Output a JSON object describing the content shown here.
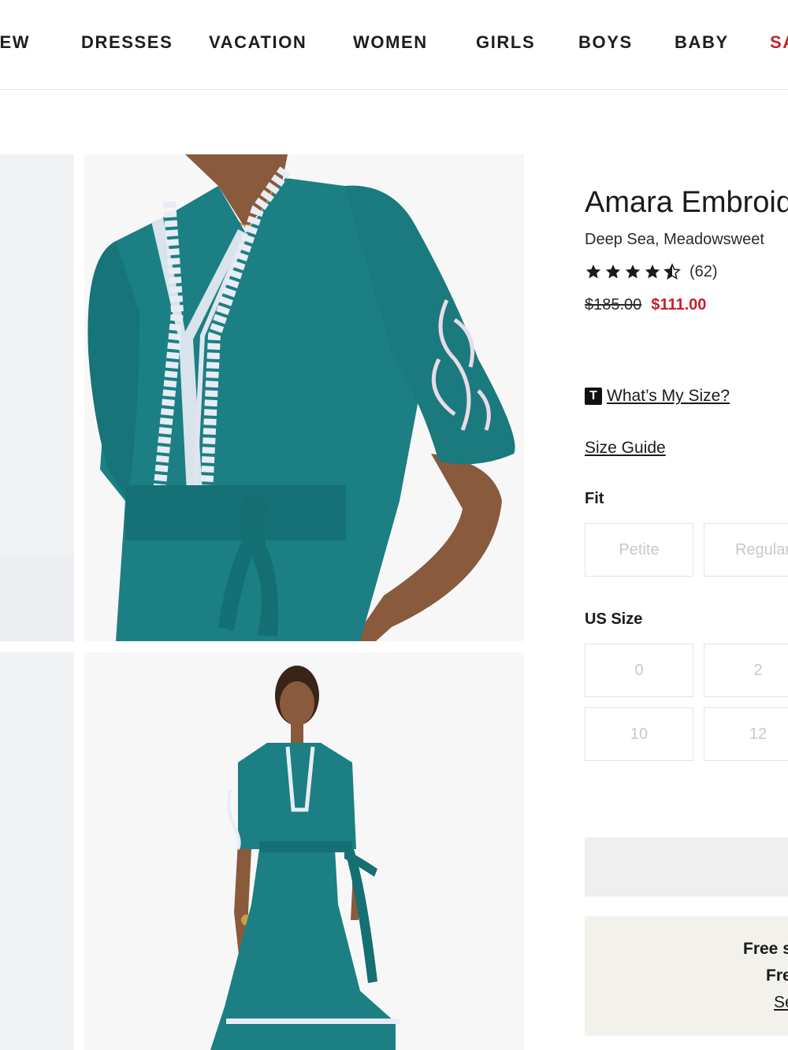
{
  "nav": {
    "items": [
      {
        "label": "NEW"
      },
      {
        "label": "DRESSES"
      },
      {
        "label": "VACATION"
      },
      {
        "label": "WOMEN"
      },
      {
        "label": "GIRLS"
      },
      {
        "label": "BOYS"
      },
      {
        "label": "BABY"
      },
      {
        "label": "SALE"
      }
    ],
    "sale_color": "#c8202b"
  },
  "product": {
    "title": "Amara Embroidered",
    "color": "Deep Sea, Meadowsweet",
    "rating": 4.5,
    "review_count": "(62)",
    "price_original": "$185.00",
    "price_sale": "$111.00",
    "sale_color": "#c8202b",
    "dress_color": "#1b7f83"
  },
  "sizing": {
    "whats_my_size_badge": "T",
    "whats_my_size": "What’s My Size?",
    "size_guide": "Size Guide",
    "fit_label": "Fit",
    "fit_options": [
      "Petite",
      "Regular"
    ],
    "size_label": "US Size",
    "size_options": [
      "0",
      "2",
      "10",
      "12"
    ]
  },
  "shipping": {
    "line1": "Free s",
    "line2": "Fre",
    "line3": "Se"
  }
}
